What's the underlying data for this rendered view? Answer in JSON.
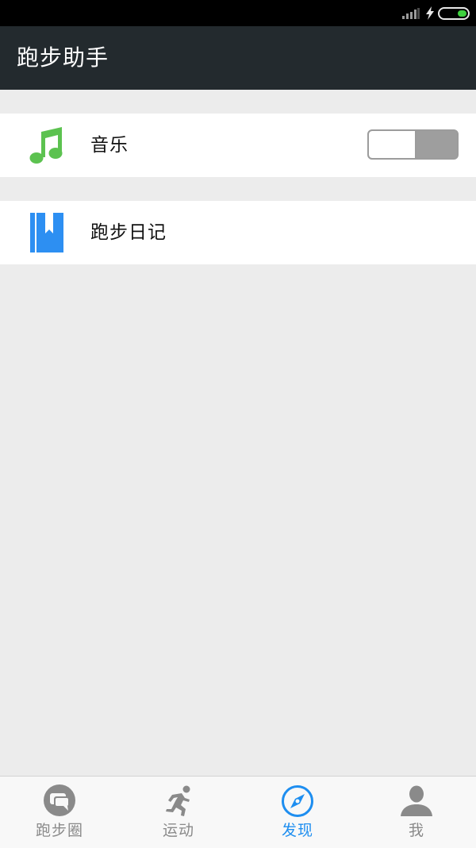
{
  "app": {
    "title": "跑步助手"
  },
  "status_bar": {
    "signal_icon": "signal-icon",
    "charging_icon": "charging-bolt-icon",
    "battery_icon": "battery-icon",
    "battery_color": "#3fd13f"
  },
  "settings": {
    "items": [
      {
        "label": "音乐",
        "icon": "music-note-icon",
        "icon_color": "#5cc250",
        "toggle_on": false
      },
      {
        "label": "跑步日记",
        "icon": "diary-book-icon",
        "icon_color": "#2d8ff2"
      }
    ]
  },
  "bottom_nav": {
    "active_color": "#1e8ef0",
    "inactive_color": "#8a8a8a",
    "items": [
      {
        "label": "跑步圈",
        "icon": "chat-bubble-icon",
        "active": false
      },
      {
        "label": "运动",
        "icon": "runner-icon",
        "active": false
      },
      {
        "label": "发现",
        "icon": "compass-icon",
        "active": true
      },
      {
        "label": "我",
        "icon": "person-icon",
        "active": false
      }
    ]
  }
}
